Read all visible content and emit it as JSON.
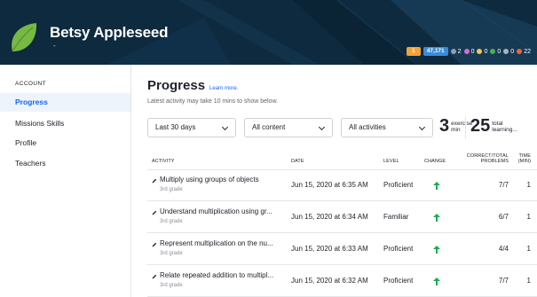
{
  "header": {
    "user_name": "Betsy Appleseed",
    "user_sub": "-",
    "stats": {
      "orange_badge": "1",
      "points": "47,171",
      "badges": [
        {
          "icon": "meteorite-badge-icon",
          "color": "#8d9fb0",
          "count": "2"
        },
        {
          "icon": "moon-badge-icon",
          "color": "#d86dc7",
          "count": "0"
        },
        {
          "icon": "earth-badge-icon",
          "color": "#f2c94c",
          "count": "0"
        },
        {
          "icon": "sun-badge-icon",
          "color": "#4caf50",
          "count": "0"
        },
        {
          "icon": "black-hole-badge-icon",
          "color": "#a7b3bf",
          "count": "0"
        },
        {
          "icon": "challenge-patch-icon",
          "color": "#e9673c",
          "count": "22"
        }
      ]
    }
  },
  "sidebar": {
    "heading": "ACCOUNT",
    "items": [
      {
        "label": "Progress",
        "active": true
      },
      {
        "label": "Missions Skills",
        "active": false
      },
      {
        "label": "Profile",
        "active": false
      },
      {
        "label": "Teachers",
        "active": false
      }
    ]
  },
  "main": {
    "title": "Progress",
    "learn_more": "Learn more.",
    "subtitle": "Latest activity may take 10 mins to show below.",
    "filters": {
      "time_range": "Last 30 days",
      "content": "All content",
      "activities": "All activities"
    },
    "summary": {
      "exercise_count": "3",
      "exercise_label_1": "exercise",
      "exercise_label_2": "min",
      "learning_count": "25",
      "learning_label_1": "total",
      "learning_label_2": "learning..."
    },
    "table": {
      "headers": {
        "activity": "ACTIVITY",
        "date": "DATE",
        "level": "LEVEL",
        "change": "CHANGE",
        "correct_1": "CORRECT/TOTAL",
        "correct_2": "PROBLEMS",
        "time_1": "TIME",
        "time_2": "(MIN)"
      },
      "rows": [
        {
          "title": "Multiply using groups of objects",
          "grade": "3rd grade",
          "date": "Jun 15, 2020 at 6:35 AM",
          "level": "Proficient",
          "change": "up",
          "score": "7/7",
          "time": "1"
        },
        {
          "title": "Understand multiplication using gr...",
          "grade": "3rd grade",
          "date": "Jun 15, 2020 at 6:34 AM",
          "level": "Familiar",
          "change": "up",
          "score": "6/7",
          "time": "1"
        },
        {
          "title": "Represent multiplication on the nu...",
          "grade": "3rd grade",
          "date": "Jun 15, 2020 at 6:33 AM",
          "level": "Proficient",
          "change": "up",
          "score": "4/4",
          "time": "1"
        },
        {
          "title": "Relate repeated addition to multipl...",
          "grade": "3rd grade",
          "date": "Jun 15, 2020 at 6:32 AM",
          "level": "Proficient",
          "change": "up",
          "score": "7/7",
          "time": "1"
        }
      ]
    }
  },
  "colors": {
    "header_bg": "#0e2a3e",
    "accent_blue": "#1865f2",
    "leaf_green": "#76b943",
    "up_arrow_green": "#1fab54"
  }
}
